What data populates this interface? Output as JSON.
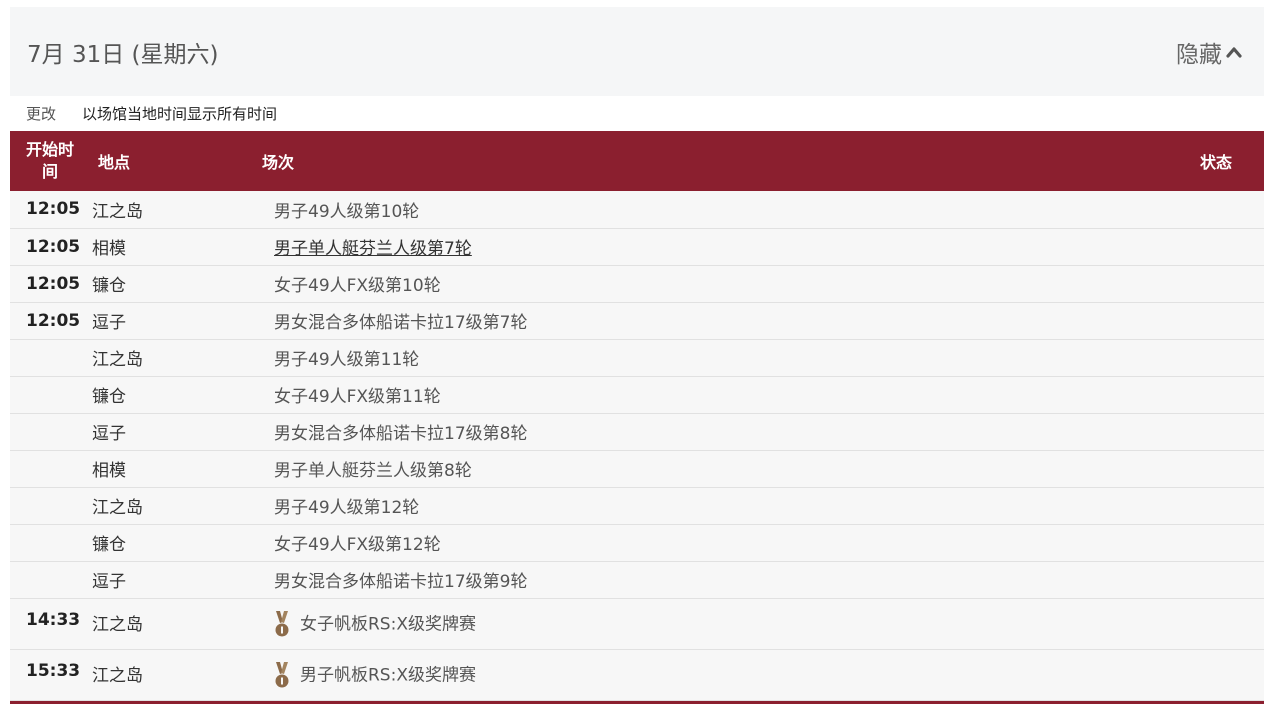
{
  "day": {
    "title": "7月 31日 (星期六)",
    "toggle_label": "隐藏"
  },
  "timezone": {
    "change_label": "更改",
    "note": "以场馆当地时间显示所有时间"
  },
  "table": {
    "headers": {
      "time": "开始时间",
      "location": "地点",
      "event": "场次",
      "status": "状态"
    },
    "rows": [
      {
        "time": "12:05",
        "location": "江之岛",
        "event": "男子49人级第10轮",
        "link": false,
        "medal": false
      },
      {
        "time": "12:05",
        "location": "相模",
        "event": "男子单人艇芬兰人级第7轮",
        "link": true,
        "medal": false
      },
      {
        "time": "12:05",
        "location": "镰仓",
        "event": "女子49人FX级第10轮",
        "link": false,
        "medal": false
      },
      {
        "time": "12:05",
        "location": "逗子",
        "event": "男女混合多体船诺卡拉17级第7轮",
        "link": false,
        "medal": false
      },
      {
        "time": "",
        "location": "江之岛",
        "event": "男子49人级第11轮",
        "link": false,
        "medal": false
      },
      {
        "time": "",
        "location": "镰仓",
        "event": "女子49人FX级第11轮",
        "link": false,
        "medal": false
      },
      {
        "time": "",
        "location": "逗子",
        "event": "男女混合多体船诺卡拉17级第8轮",
        "link": false,
        "medal": false
      },
      {
        "time": "",
        "location": "相模",
        "event": "男子单人艇芬兰人级第8轮",
        "link": false,
        "medal": false
      },
      {
        "time": "",
        "location": "江之岛",
        "event": "男子49人级第12轮",
        "link": false,
        "medal": false
      },
      {
        "time": "",
        "location": "镰仓",
        "event": "女子49人FX级第12轮",
        "link": false,
        "medal": false
      },
      {
        "time": "",
        "location": "逗子",
        "event": "男女混合多体船诺卡拉17级第9轮",
        "link": false,
        "medal": false
      },
      {
        "time": "14:33",
        "location": "江之岛",
        "event": "女子帆板RS:X级奖牌赛",
        "link": false,
        "medal": true
      },
      {
        "time": "15:33",
        "location": "江之岛",
        "event": "男子帆板RS:X级奖牌赛",
        "link": false,
        "medal": true
      }
    ]
  },
  "colors": {
    "header_bg": "#8b1f2f",
    "medal": "#8c6b4a"
  },
  "icons": {
    "toggle": "chevron-up-icon",
    "medal": "medal-icon"
  }
}
